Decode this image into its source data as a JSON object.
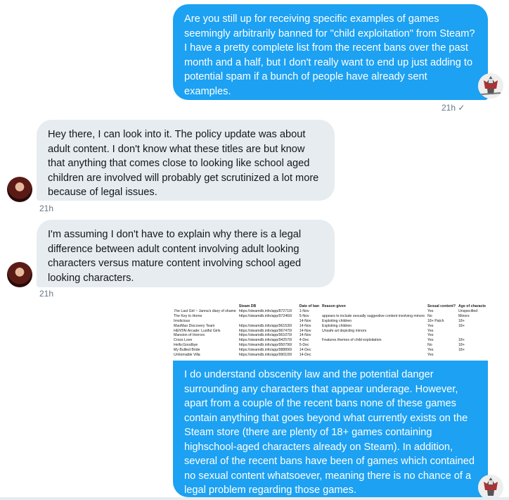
{
  "messages": [
    {
      "text": "Are you still up for receiving specific examples of games seemingly arbitrarily banned for \"child exploitation\" from Steam? I have a pretty complete list from the recent bans over the past month and a half, but I don't really want to end up just adding to potential spam if a bunch of people have already sent examples.",
      "time": "21h",
      "check": "✓"
    },
    {
      "text": "Hey there, I can look into it. The policy update was about adult content. I don't know what these titles are but know that anything that comes close to looking like school aged children are involved will probably get scrutinized a lot more because of legal issues.",
      "time": "21h"
    },
    {
      "text": "I'm assuming I don't have to explain why there is a legal difference between adult content involving adult looking characters versus mature content involving school aged looking characters.",
      "time": "21h"
    },
    {
      "text": "I do understand obscenity law and the potential danger surrounding any characters that appear underage. However, apart from a couple of the recent bans none of these games contain anything that goes beyond what currently exists on the Steam store (there are plenty of 18+ games containing highschool-aged characters already on Steam). In addition, several of the recent bans have been of games which contained no sexual content whatsoever, meaning there is no chance of a legal problem regarding those games."
    }
  ],
  "attachment": {
    "headers": [
      "",
      "Steam DB",
      "Date of ban",
      "Reason given",
      "Sexual content?",
      "Age of characte"
    ],
    "rows": [
      [
        "The Last Girl ~ Janna's diary of shame",
        "https://steamdb.info/app/872710/",
        "1-Nov",
        "",
        "Yes",
        "Unspecified"
      ],
      [
        "The Key to Home",
        "https://steamdb.info/app/972460/",
        "5-Nov",
        "appears to include sexually suggestive content involving minors",
        "No",
        "Minors"
      ],
      [
        "Imolicious",
        "",
        "14-Nov",
        "Exploiting children",
        "18+ Patch",
        "18+"
      ],
      [
        "MaoMao Discovery Team",
        "https://steamdb.info/app/961530/",
        "14-Nov",
        "Exploiting children",
        "Yes",
        "18+"
      ],
      [
        "HENTAI Arcade: Lustful Girls",
        "https://steamdb.info/app/967470/",
        "14-Nov",
        "Unsafe art depicting minors",
        "Yes",
        ""
      ],
      [
        "Mansion of Horrors",
        "https://steamdb.info/app/961070/",
        "14-Nov",
        "",
        "Yes",
        ""
      ],
      [
        "Cross Love",
        "https://steamdb.info/app/942570/",
        "4-Dec",
        "Features themes of child exploitation",
        "Yes",
        "18+"
      ],
      [
        "Hello;Goodbye",
        "https://steamdb.info/app/950790/",
        "5-Dec",
        "",
        "No",
        "18+"
      ],
      [
        "My Bullied Bride",
        "https://steamdb.info/app/988890/",
        "14-Dec",
        "",
        "Yes",
        "18+"
      ],
      [
        "Unhomable Villa",
        "https://steamdb.info/app/990100/",
        "14-Dec",
        "",
        "Yes",
        ""
      ]
    ]
  }
}
